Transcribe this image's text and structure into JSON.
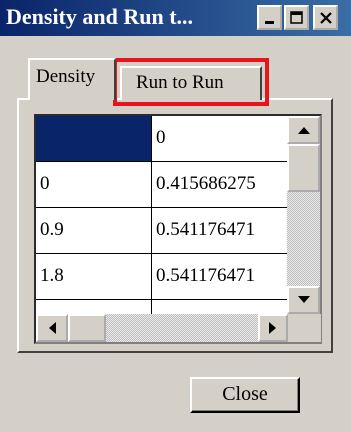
{
  "window": {
    "title": "Density and Run t..."
  },
  "tabs": [
    {
      "label": "Density"
    },
    {
      "label": "Run to Run"
    }
  ],
  "grid": {
    "header": [
      "",
      "0"
    ],
    "rows": [
      [
        "0",
        "0.415686275"
      ],
      [
        "0.9",
        "0.541176471"
      ],
      [
        "1.8",
        "0.541176471"
      ]
    ]
  },
  "buttons": {
    "close": "Close"
  },
  "icons": {
    "minimize": "minimize-icon",
    "maximize": "maximize-icon",
    "close": "close-icon",
    "scroll_up": "arrow-up-icon",
    "scroll_down": "arrow-down-icon",
    "scroll_left": "arrow-left-icon",
    "scroll_right": "arrow-right-icon"
  },
  "colors": {
    "title_bar": "#0a246a",
    "selected_cell": "#0a246a",
    "highlight": "#e8141b"
  }
}
